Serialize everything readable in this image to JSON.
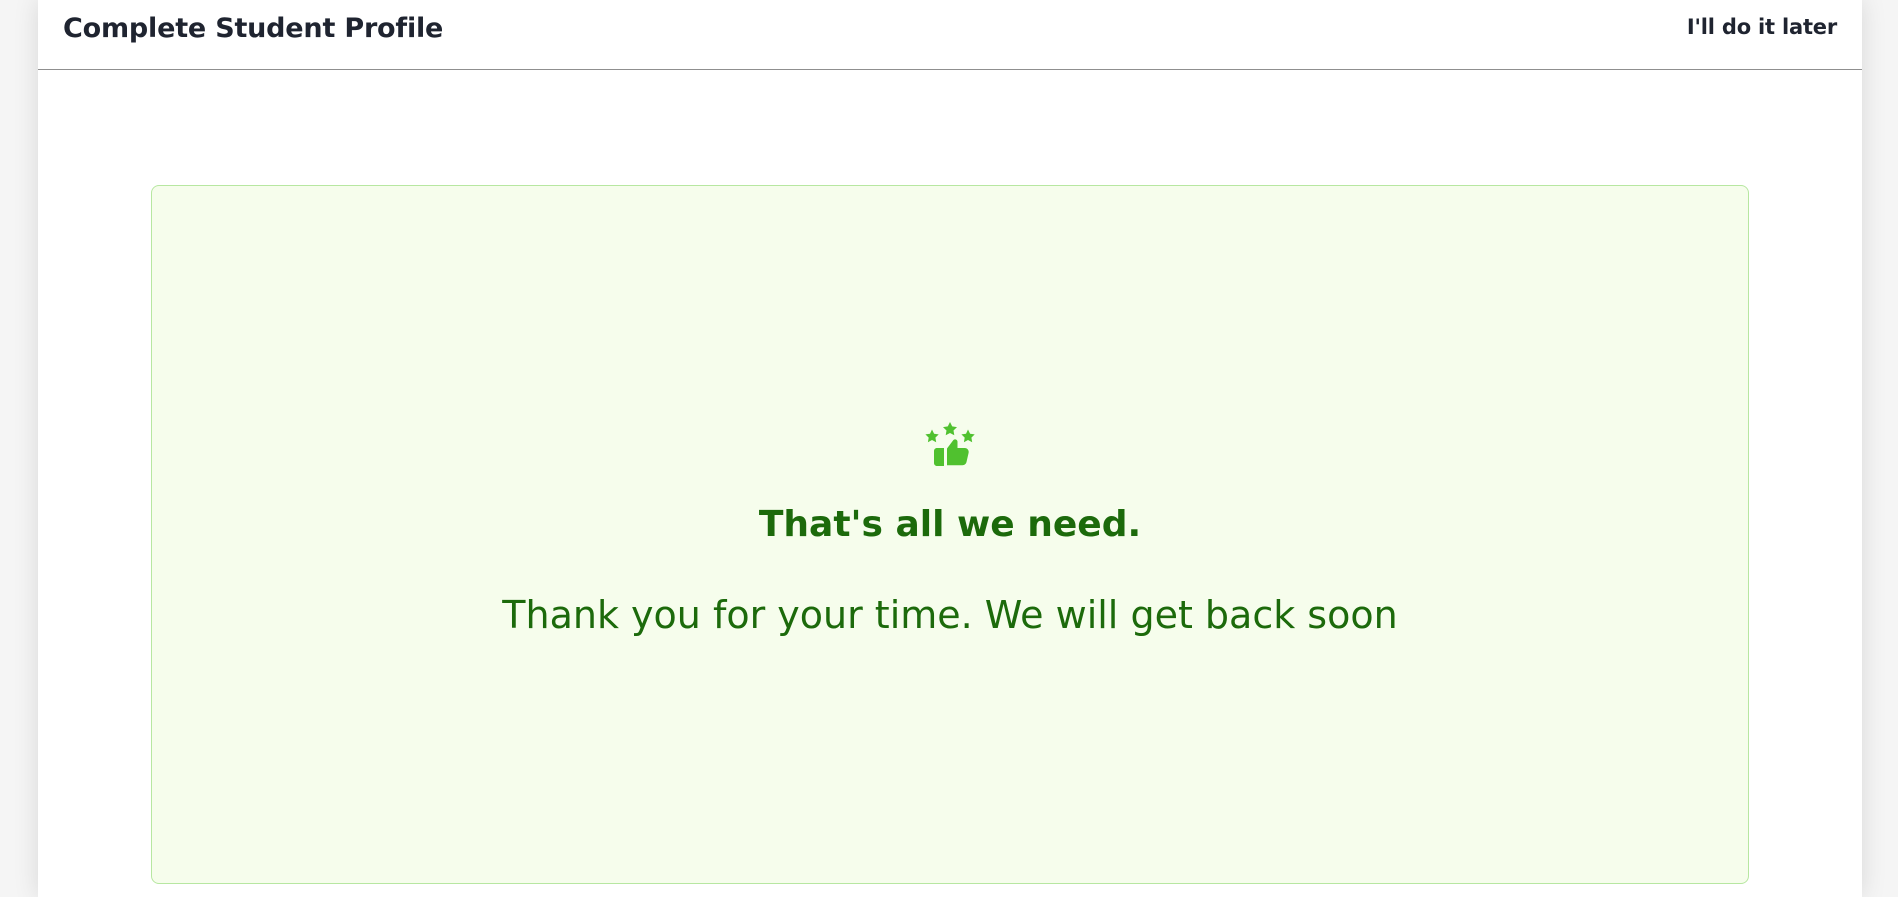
{
  "header": {
    "title": "Complete Student Profile",
    "later_label": "I'll do it later"
  },
  "success": {
    "icon": "thumbs-up-stars-icon",
    "title": "That's all we need.",
    "message": "Thank you for your time. We will get back soon"
  },
  "colors": {
    "accent_green": "#50c12f",
    "dark_green_text": "#1c6a0b",
    "panel_background": "#f6fdec",
    "panel_border": "#b7e7a1",
    "header_text": "#1f2430"
  }
}
